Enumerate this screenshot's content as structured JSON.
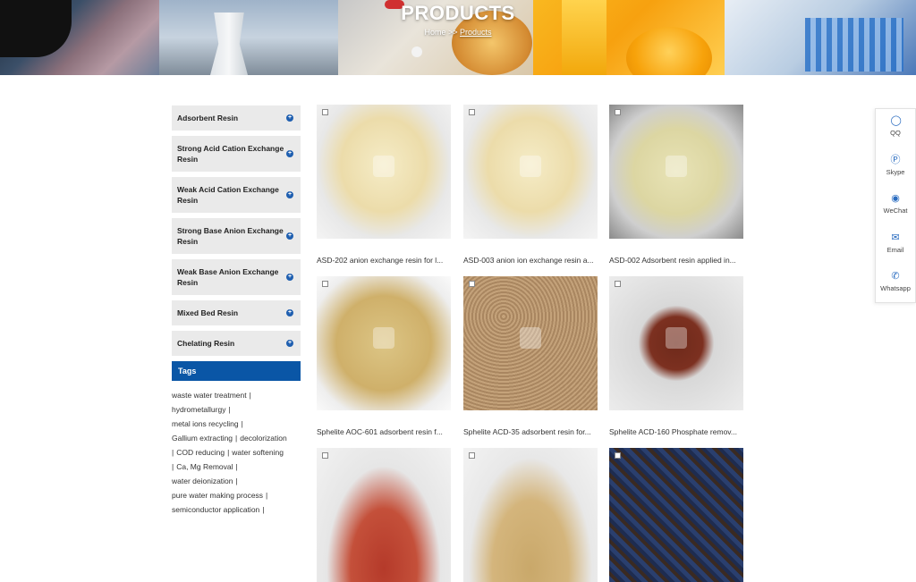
{
  "banner": {
    "title": "PRODUCTS",
    "breadcrumb_home": "Home",
    "breadcrumb_sep": ">>",
    "breadcrumb_current": "Products"
  },
  "sidebar": {
    "categories": [
      {
        "label": "Adsorbent Resin"
      },
      {
        "label": "Strong Acid Cation Exchange Resin"
      },
      {
        "label": "Weak Acid Cation Exchange Resin"
      },
      {
        "label": "Strong Base Anion Exchange Resin"
      },
      {
        "label": "Weak Base Anion Exchange Resin"
      },
      {
        "label": "Mixed Bed Resin"
      },
      {
        "label": "Chelating Resin"
      }
    ],
    "tags_heading": "Tags",
    "tags": [
      "waste water treatment",
      "hydrometallurgy",
      "metal ions recycling",
      "Gallium extracting",
      "decolorization",
      "COD reducing",
      "water softening",
      "Ca, Mg Removal",
      "water deionization",
      "pure water making process",
      "semiconductor application"
    ]
  },
  "products": [
    {
      "caption": "ASD-202 anion exchange resin for l...",
      "color": "#efe2b8"
    },
    {
      "caption": "ASD-003 anion ion exchange resin a...",
      "color": "#efe2b8"
    },
    {
      "caption": "ASD-002 Adsorbent resin applied in...",
      "color": "#e4dfb2"
    },
    {
      "caption": "Sphelite AOC-601 adsorbent resin f...",
      "color": "#d9c27e"
    },
    {
      "caption": "Sphelite ACD-35 adsorbent resin for...",
      "color": "#b8956c"
    },
    {
      "caption": "Sphelite ACD-160 Phosphate remov...",
      "color": "#7a2d1c"
    },
    {
      "caption": "",
      "color": "#b53a2a"
    },
    {
      "caption": "",
      "color": "#c9a86a"
    },
    {
      "caption": "",
      "color": "#3a2a22"
    }
  ],
  "float_panel": {
    "items": [
      {
        "label": "QQ",
        "icon": "qq-icon"
      },
      {
        "label": "Skype",
        "icon": "skype-icon"
      },
      {
        "label": "WeChat",
        "icon": "wechat-icon"
      },
      {
        "label": "Email",
        "icon": "email-icon"
      },
      {
        "label": "Whatsapp",
        "icon": "whatsapp-icon"
      }
    ]
  }
}
